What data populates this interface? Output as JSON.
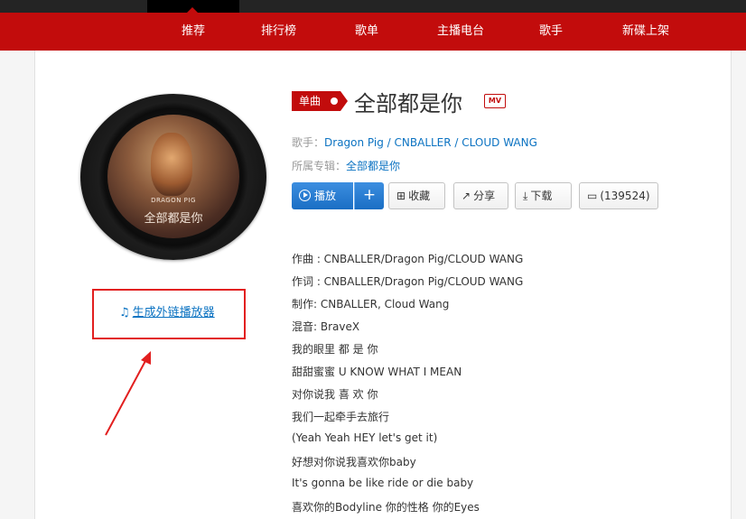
{
  "nav": {
    "items": [
      "推荐",
      "排行榜",
      "歌单",
      "主播电台",
      "歌手",
      "新碟上架"
    ]
  },
  "song": {
    "badge": "单曲",
    "title": "全部都是你",
    "mv_label": "MV",
    "artist_label": "歌手：",
    "artists": "Dragon Pig / CNBALLER / CLOUD WANG",
    "album_label": "所属专辑：",
    "album": "全部都是你",
    "cover_small_text": "DRAGON PIG",
    "cover_title": "全部都是你"
  },
  "actions": {
    "play": "播放",
    "add": "+",
    "collect": "收藏",
    "share": "分享",
    "download": "下载",
    "comments": "(139524)"
  },
  "external_player": {
    "label": "生成外链播放器"
  },
  "lyrics": [
    "作曲 : CNBALLER/Dragon Pig/CLOUD WANG",
    "作词 : CNBALLER/Dragon Pig/CLOUD WANG",
    "制作: CNBALLER, Cloud Wang",
    "混音: BraveX",
    "我的眼里 都 是 你",
    "甜甜蜜蜜 U KNOW WHAT I MEAN",
    "对你说我 喜 欢 你",
    "我们一起牵手去旅行",
    "(Yeah Yeah HEY let's get it)",
    "好想对你说我喜欢你baby",
    "It's gonna be like ride or die baby",
    "喜欢你的Bodyline 你的性格 你的Eyes"
  ],
  "colors": {
    "brand_red": "#c20c0c",
    "link_blue": "#0c73c2",
    "play_blue": "#2a7fd6",
    "annotation_red": "#e21f1f"
  }
}
